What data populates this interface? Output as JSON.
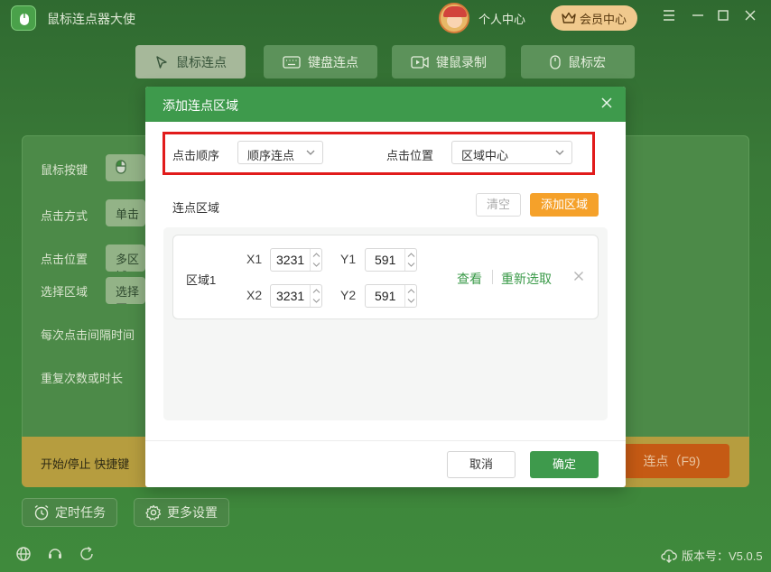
{
  "app": {
    "title": "鼠标连点器大使",
    "user_label": "个人中心",
    "vip_label": "会员中心",
    "version": "版本号：V5.0.5"
  },
  "nav": {
    "tabs": [
      {
        "label": "鼠标连点",
        "icon": "cursor-icon",
        "active": true
      },
      {
        "label": "键盘连点",
        "icon": "keyboard-icon",
        "active": false
      },
      {
        "label": "键鼠录制",
        "icon": "record-icon",
        "active": false
      },
      {
        "label": "鼠标宏",
        "icon": "mouse-icon",
        "active": false
      }
    ]
  },
  "background_form": {
    "mouse_button_label": "鼠标按键",
    "click_mode_label": "点击方式",
    "click_mode_value": "单击",
    "click_position_label": "点击位置",
    "click_position_value": "多区域",
    "select_area_label": "选择区域",
    "select_area_value": "选择区",
    "interval_label": "每次点击间隔时间",
    "repeat_label": "重复次数或时长",
    "hotkey_label": "开始/停止 快捷键",
    "start_button_label": "连点（F9)"
  },
  "footer": {
    "timer_task_label": "定时任务",
    "more_settings_label": "更多设置"
  },
  "modal": {
    "title": "添加连点区域",
    "click_order_label": "点击顺序",
    "click_order_value": "顺序连点",
    "click_position_label": "点击位置",
    "click_position_value": "区域中心",
    "area_section_label": "连点区域",
    "clear_label": "清空",
    "add_area_label": "添加区域",
    "areas": [
      {
        "name": "区域1",
        "x1_label": "X1",
        "x1": "3231",
        "y1_label": "Y1",
        "y1": "591",
        "x2_label": "X2",
        "x2": "3231",
        "y2_label": "Y2",
        "y2": "591",
        "view_label": "查看",
        "reselect_label": "重新选取"
      }
    ],
    "cancel_label": "取消",
    "ok_label": "确定"
  },
  "colors": {
    "accent_green": "#3e9a4c",
    "accent_orange": "#f5a12a",
    "highlight_red": "#e11b1b"
  }
}
